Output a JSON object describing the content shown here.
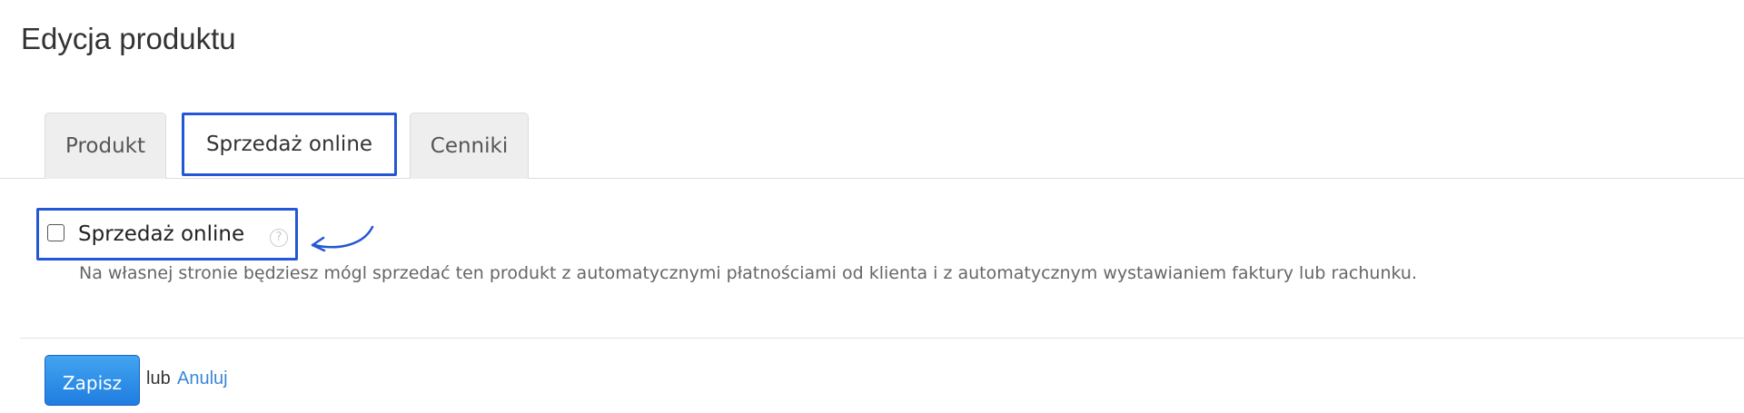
{
  "page": {
    "title": "Edycja produktu"
  },
  "tabs": [
    {
      "label": "Produkt",
      "active": false
    },
    {
      "label": "Sprzedaż online",
      "active": true
    },
    {
      "label": "Cenniki",
      "active": false
    }
  ],
  "online_sales": {
    "checkbox_label": "Sprzedaż online",
    "checked": false,
    "help_icon": "?",
    "description": "Na własnej stronie będziesz mógl sprzedać ten produkt z automatycznymi płatnościami od klienta i z automatycznym wystawianiem faktury lub rachunku."
  },
  "actions": {
    "save_label": "Zapisz",
    "or_text": "lub",
    "cancel_label": "Anuluj"
  },
  "colors": {
    "highlight": "#2457d6",
    "primary_button": "#1f7de0",
    "link": "#3a87d8"
  }
}
